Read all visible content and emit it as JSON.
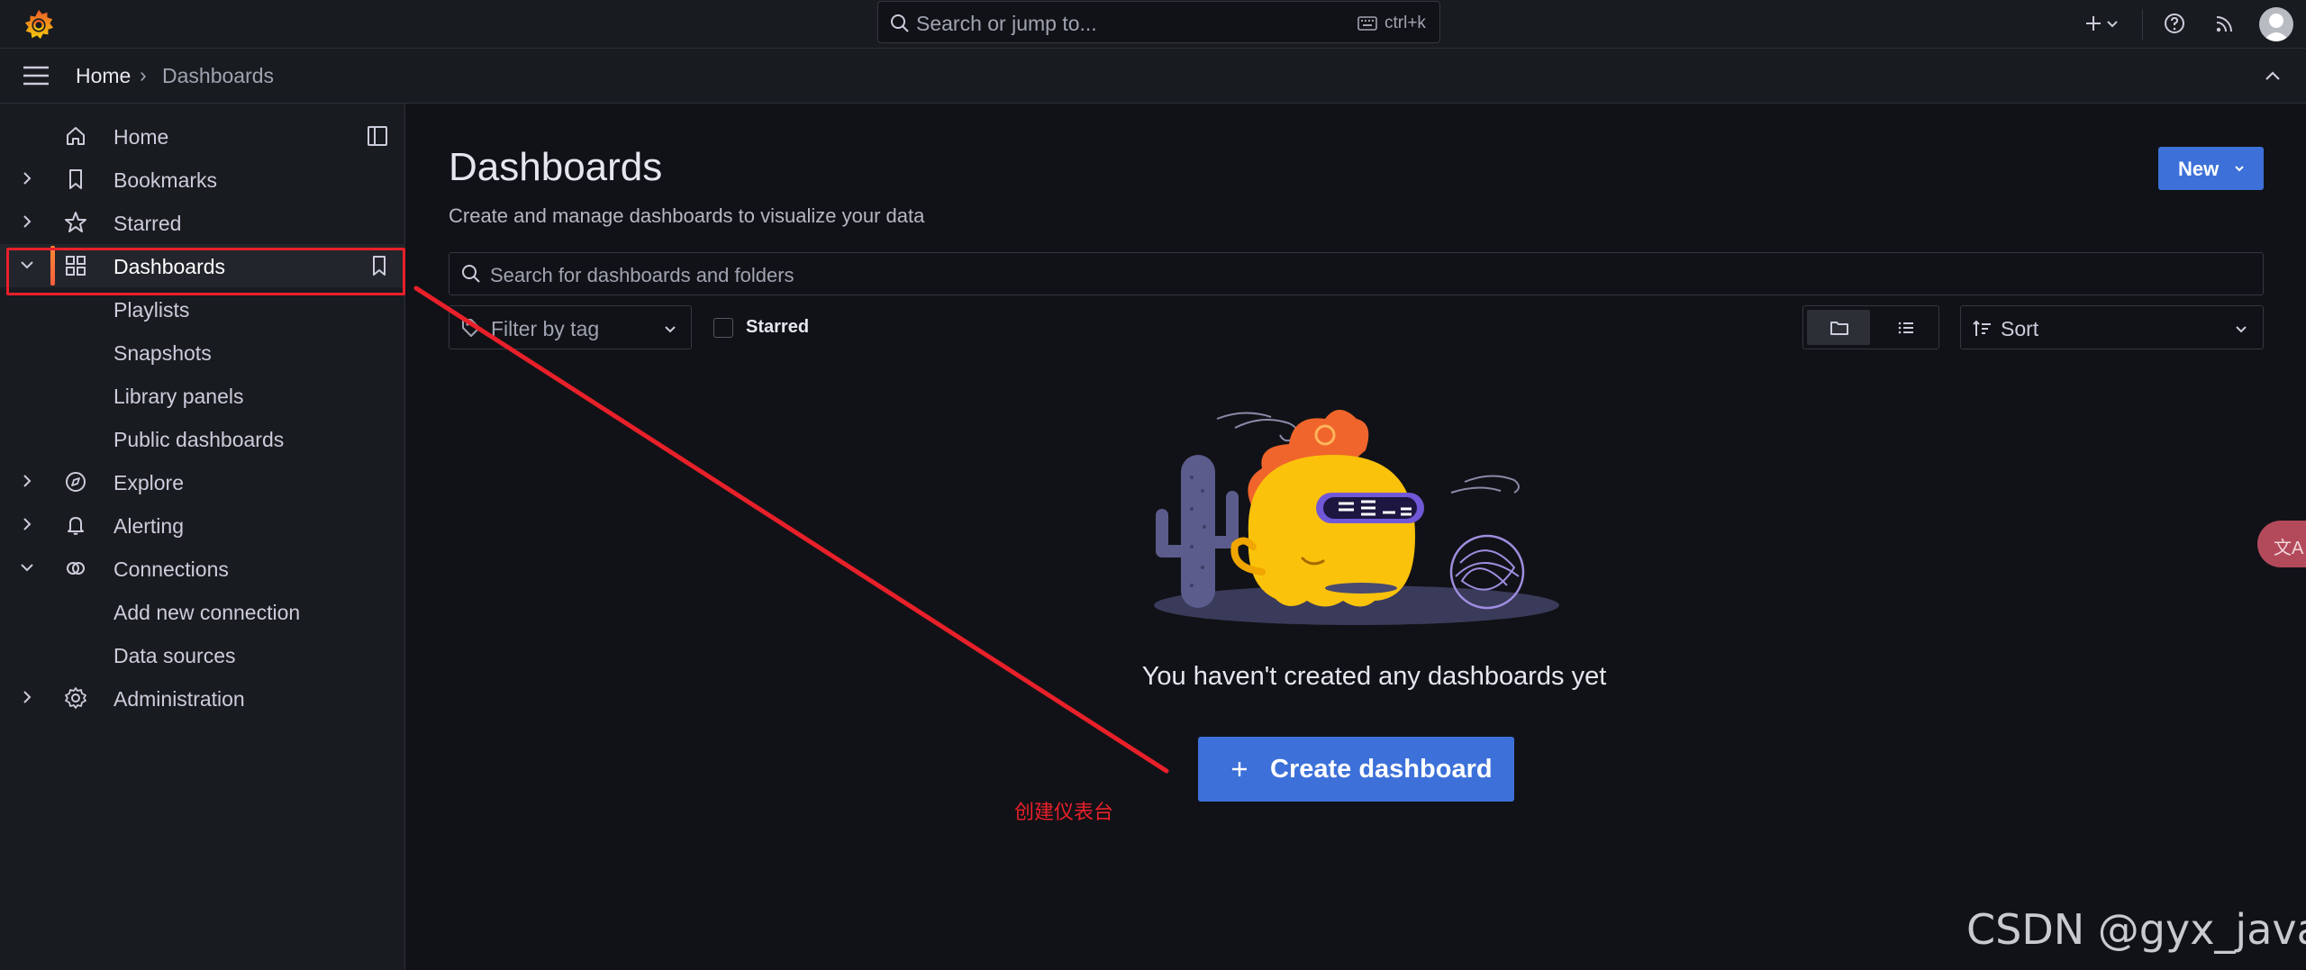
{
  "topbar": {
    "search_placeholder": "Search or jump to...",
    "shortcut_label": "ctrl+k"
  },
  "breadcrumb": {
    "home": "Home",
    "separator": "›",
    "current": "Dashboards"
  },
  "sidebar": {
    "items": [
      {
        "label": "Home"
      },
      {
        "label": "Bookmarks"
      },
      {
        "label": "Starred"
      },
      {
        "label": "Dashboards"
      },
      {
        "label": "Playlists"
      },
      {
        "label": "Snapshots"
      },
      {
        "label": "Library panels"
      },
      {
        "label": "Public dashboards"
      },
      {
        "label": "Explore"
      },
      {
        "label": "Alerting"
      },
      {
        "label": "Connections"
      },
      {
        "label": "Add new connection"
      },
      {
        "label": "Data sources"
      },
      {
        "label": "Administration"
      }
    ]
  },
  "main": {
    "title": "Dashboards",
    "subtitle": "Create and manage dashboards to visualize your data",
    "new_button": "New",
    "search_placeholder": "Search for dashboards and folders",
    "filter_tag_placeholder": "Filter by tag",
    "starred_label": "Starred",
    "sort_placeholder": "Sort",
    "empty_message": "You haven't created any dashboards yet",
    "create_button": "Create dashboard"
  },
  "annotation": {
    "text": "创建仪表台"
  },
  "watermark": {
    "text": "CSDN @gyx_java"
  },
  "translate_bubble": {
    "text": "文A"
  },
  "colors": {
    "accent_blue": "#3d71d9",
    "active_orange": "#ff8833",
    "annotation_red": "#e8202a",
    "background": "#111217",
    "panel": "#181b1f"
  }
}
